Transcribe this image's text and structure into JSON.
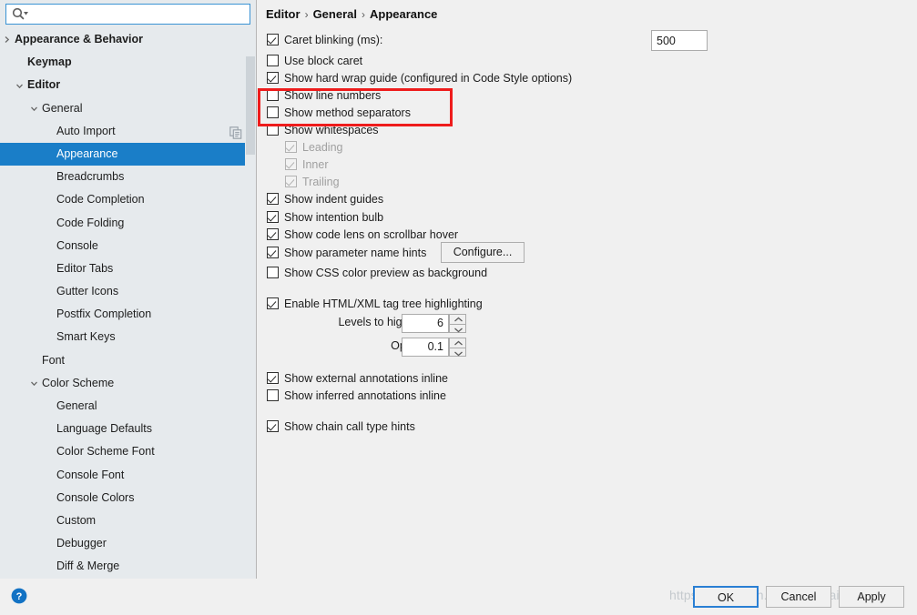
{
  "search": {
    "placeholder": "",
    "value": "",
    "icon": "search-icon"
  },
  "sidebar": {
    "items": [
      {
        "label": "Appearance & Behavior",
        "indent": 16,
        "arrow": "right",
        "bold": true,
        "selected": false,
        "trailing_icon": ""
      },
      {
        "label": "Keymap",
        "indent": 30,
        "arrow": "",
        "bold": true,
        "selected": false,
        "trailing_icon": ""
      },
      {
        "label": "Editor",
        "indent": 30,
        "arrow": "down",
        "bold": true,
        "selected": false,
        "trailing_icon": ""
      },
      {
        "label": "General",
        "indent": 46,
        "arrow": "down",
        "bold": false,
        "selected": false,
        "trailing_icon": ""
      },
      {
        "label": "Auto Import",
        "indent": 62,
        "arrow": "",
        "bold": false,
        "selected": false,
        "trailing_icon": "copy-icon"
      },
      {
        "label": "Appearance",
        "indent": 62,
        "arrow": "",
        "bold": false,
        "selected": true,
        "trailing_icon": ""
      },
      {
        "label": "Breadcrumbs",
        "indent": 62,
        "arrow": "",
        "bold": false,
        "selected": false,
        "trailing_icon": ""
      },
      {
        "label": "Code Completion",
        "indent": 62,
        "arrow": "",
        "bold": false,
        "selected": false,
        "trailing_icon": ""
      },
      {
        "label": "Code Folding",
        "indent": 62,
        "arrow": "",
        "bold": false,
        "selected": false,
        "trailing_icon": ""
      },
      {
        "label": "Console",
        "indent": 62,
        "arrow": "",
        "bold": false,
        "selected": false,
        "trailing_icon": ""
      },
      {
        "label": "Editor Tabs",
        "indent": 62,
        "arrow": "",
        "bold": false,
        "selected": false,
        "trailing_icon": ""
      },
      {
        "label": "Gutter Icons",
        "indent": 62,
        "arrow": "",
        "bold": false,
        "selected": false,
        "trailing_icon": ""
      },
      {
        "label": "Postfix Completion",
        "indent": 62,
        "arrow": "",
        "bold": false,
        "selected": false,
        "trailing_icon": ""
      },
      {
        "label": "Smart Keys",
        "indent": 62,
        "arrow": "",
        "bold": false,
        "selected": false,
        "trailing_icon": ""
      },
      {
        "label": "Font",
        "indent": 46,
        "arrow": "",
        "bold": false,
        "selected": false,
        "trailing_icon": ""
      },
      {
        "label": "Color Scheme",
        "indent": 46,
        "arrow": "down",
        "bold": false,
        "selected": false,
        "trailing_icon": ""
      },
      {
        "label": "General",
        "indent": 62,
        "arrow": "",
        "bold": false,
        "selected": false,
        "trailing_icon": ""
      },
      {
        "label": "Language Defaults",
        "indent": 62,
        "arrow": "",
        "bold": false,
        "selected": false,
        "trailing_icon": ""
      },
      {
        "label": "Color Scheme Font",
        "indent": 62,
        "arrow": "",
        "bold": false,
        "selected": false,
        "trailing_icon": ""
      },
      {
        "label": "Console Font",
        "indent": 62,
        "arrow": "",
        "bold": false,
        "selected": false,
        "trailing_icon": ""
      },
      {
        "label": "Console Colors",
        "indent": 62,
        "arrow": "",
        "bold": false,
        "selected": false,
        "trailing_icon": ""
      },
      {
        "label": "Custom",
        "indent": 62,
        "arrow": "",
        "bold": false,
        "selected": false,
        "trailing_icon": ""
      },
      {
        "label": "Debugger",
        "indent": 62,
        "arrow": "",
        "bold": false,
        "selected": false,
        "trailing_icon": ""
      },
      {
        "label": "Diff & Merge",
        "indent": 62,
        "arrow": "",
        "bold": false,
        "selected": false,
        "trailing_icon": ""
      }
    ]
  },
  "breadcrumb": {
    "part1": "Editor",
    "sep1": "›",
    "part2": "General",
    "sep2": "›",
    "part3": "Appearance"
  },
  "settings": {
    "caret_blinking_label": "Caret blinking (ms):",
    "caret_blinking_value": "500",
    "use_block_caret": "Use block caret",
    "show_hard_wrap_guide": "Show hard wrap guide (configured in Code Style options)",
    "show_line_numbers": "Show line numbers",
    "show_method_separators": "Show method separators",
    "show_whitespaces": "Show whitespaces",
    "ws_leading": "Leading",
    "ws_inner": "Inner",
    "ws_trailing": "Trailing",
    "show_indent_guides": "Show indent guides",
    "show_intention_bulb": "Show intention bulb",
    "show_code_lens": "Show code lens on scrollbar hover",
    "show_parameter_name_hints": "Show parameter name hints",
    "configure_button": "Configure...",
    "show_css_color_preview": "Show CSS color preview as background",
    "enable_tag_tree_highlighting": "Enable HTML/XML tag tree highlighting",
    "levels_label": "Levels to highlight:",
    "levels_value": "6",
    "opacity_label": "Opacity:",
    "opacity_value": "0.1",
    "show_external_annotations": "Show external annotations inline",
    "show_inferred_annotations": "Show inferred annotations inline",
    "show_chain_call_type_hints": "Show chain call type hints"
  },
  "footer": {
    "ok": "OK",
    "cancel": "Cancel",
    "apply": "Apply",
    "help_icon": "help-icon",
    "watermark": "https://blog.csdn.net/ChenHaiBike"
  },
  "colors": {
    "selection_blue": "#1a7ec8",
    "sidebar_bg": "#e6eaed",
    "panel_bg": "#f0f0f0",
    "annotation_red": "#ee1c1c",
    "focus_blue": "#2a7fd4"
  }
}
